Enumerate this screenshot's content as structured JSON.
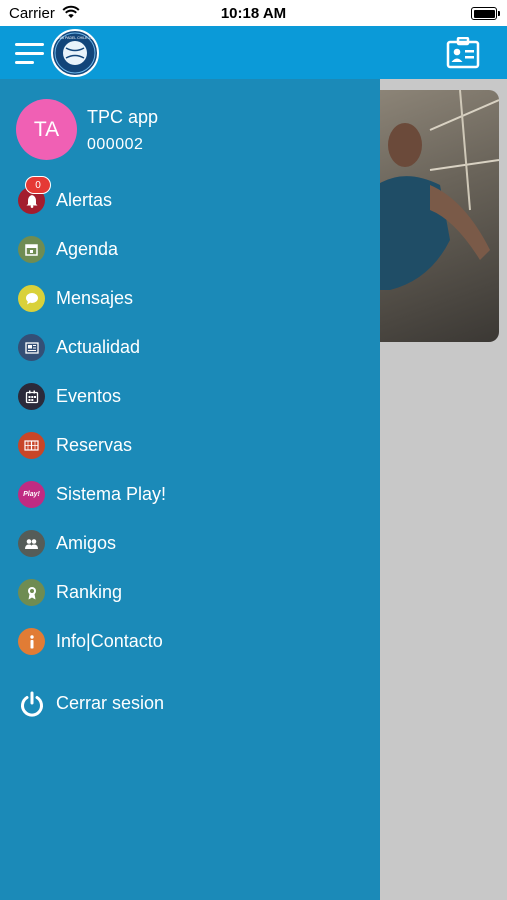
{
  "status_bar": {
    "carrier": "Carrier",
    "time": "10:18 AM"
  },
  "header": {
    "logo_text": "TENIS PADEL CHILE 2022"
  },
  "user": {
    "initials": "TA",
    "name": "TPC app",
    "id": "000002"
  },
  "menu": {
    "alertas": {
      "label": "Alertas",
      "badge": "0",
      "color": "#a31d2e"
    },
    "agenda": {
      "label": "Agenda",
      "color": "#6f8c52"
    },
    "mensajes": {
      "label": "Mensajes",
      "color": "#d9d13a"
    },
    "actualidad": {
      "label": "Actualidad",
      "color": "#344f76"
    },
    "eventos": {
      "label": "Eventos",
      "color": "#2b2a3a"
    },
    "reservas": {
      "label": "Reservas",
      "color": "#c84628"
    },
    "sistema_play": {
      "label": "Sistema Play!",
      "icon_text": "Play!",
      "color": "#c02b82"
    },
    "amigos": {
      "label": "Amigos",
      "color": "#555c58"
    },
    "ranking": {
      "label": "Ranking",
      "color": "#6f8c52"
    },
    "info": {
      "label": "Info|Contacto",
      "color": "#e17c35"
    },
    "logout": {
      "label": "Cerrar sesion"
    }
  },
  "colors": {
    "header": "#0b9ad8",
    "drawer": "#1b8ab8",
    "avatar": "#f060b4",
    "badge": "#e53935"
  }
}
